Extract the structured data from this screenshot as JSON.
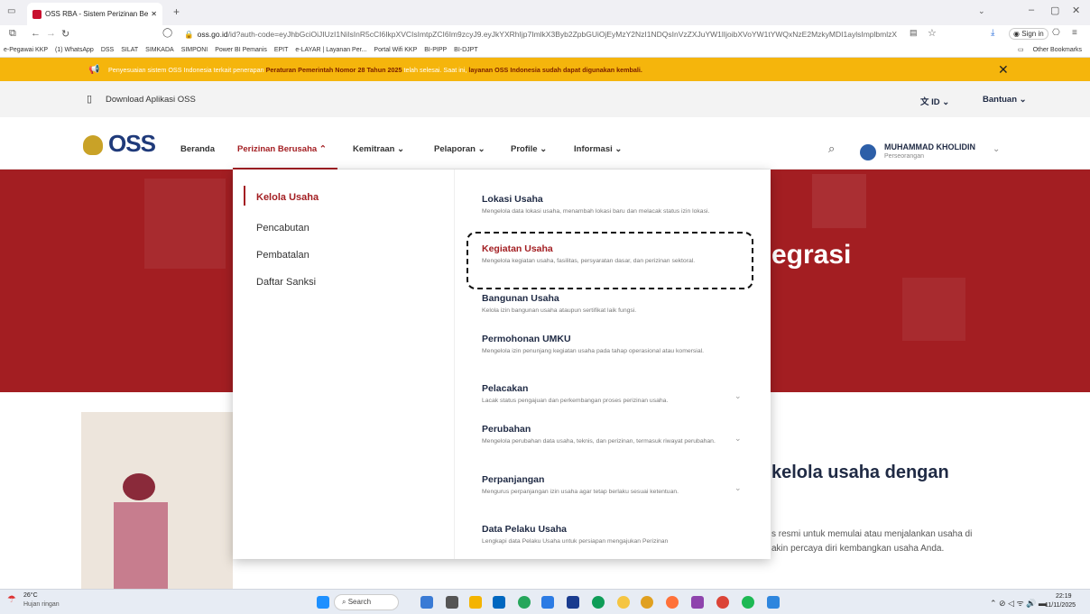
{
  "browser": {
    "tab_title": "OSS RBA - Sistem Perizinan Ber",
    "url_host": "oss.go.id",
    "url_rest": "/id?auth-code=eyJhbGciOiJIUzI1NiIsInR5cCI6IkpXVCIsImtpZCI6Im9zcyJ9.eyJkYXRhIjp7ImlkX3Byb2ZpbGUiOjEyMzY2NzI1NDQsInVzZXJuYW1lIjoibXVoYW1tYWQxNzE2MzkyMDI1aylsImplbmlzX",
    "sign_in": "Sign in",
    "bookmarks": [
      "e-Pegawai KKP",
      "(1) WhatsApp",
      "DSS",
      "SILAT",
      "SIMKADA",
      "SIMPONI",
      "Power BI Pemanis",
      "EPIT",
      "e-LAYAR | Layanan Per...",
      "Portal Wifi KKP",
      "BI-PIPP",
      "BI-DJPT"
    ],
    "other_bookmarks": "Other Bookmarks"
  },
  "announcement": {
    "pre": "Penyesuaian sistem OSS Indonesia terkait penerapan ",
    "bold1": "Peraturan Pemerintah Nomor 28 Tahun 2025",
    "mid": " telah selesai. Saat ini, ",
    "bold2": "layanan OSS Indonesia sudah dapat digunakan kembali."
  },
  "topbar": {
    "download": "Download Aplikasi OSS",
    "lang": "ID",
    "help": "Bantuan"
  },
  "header": {
    "logo": "OSS",
    "nav": [
      "Beranda",
      "Perizinan Berusaha",
      "Kemitraan",
      "Pelaporan",
      "Profile",
      "Informasi"
    ],
    "user_name": "MUHAMMAD KHOLIDIN",
    "user_type": "Perseorangan"
  },
  "hero": {
    "partial_title": "egrasi"
  },
  "lower": {
    "partial_heading": "kelola usaha dengan",
    "line1": "s resmi untuk memulai atau menjalankan usaha di",
    "line2": "akin percaya diri kembangkan usaha Anda."
  },
  "dropdown": {
    "left": [
      "Kelola Usaha",
      "Pencabutan",
      "Pembatalan",
      "Daftar Sanksi"
    ],
    "right": [
      {
        "title": "Lokasi Usaha",
        "desc": "Mengelola data lokasi usaha, menambah lokasi baru dan melacak status izin lokasi."
      },
      {
        "title": "Kegiatan Usaha",
        "desc": "Mengelola kegiatan usaha, fasilitas, persyaratan dasar, dan perizinan sektoral."
      },
      {
        "title": "Bangunan Usaha",
        "desc": "Kelola izin bangunan usaha ataupun sertifikat laik fungsi."
      },
      {
        "title": "Permohonan UMKU",
        "desc": "Mengelola izin penunjang kegiatan usaha pada tahap operasional atau komersial."
      },
      {
        "title": "Pelacakan",
        "desc": "Lacak status pengajuan dan perkembangan proses perizinan usaha."
      },
      {
        "title": "Perubahan",
        "desc": "Mengelola perubahan data usaha, teknis, dan perizinan, termasuk riwayat perubahan."
      },
      {
        "title": "Perpanjangan",
        "desc": "Mengurus perpanjangan izin usaha agar tetap berlaku sesuai ketentuan."
      },
      {
        "title": "Data Pelaku Usaha",
        "desc": "Lengkapi data Pelaku Usaha untuk persiapan mengajukan Perizinan"
      }
    ]
  },
  "taskbar": {
    "temp": "26°C",
    "weather": "Hujan ringan",
    "search": "Search",
    "time": "22:19",
    "date": "11/11/2025"
  }
}
